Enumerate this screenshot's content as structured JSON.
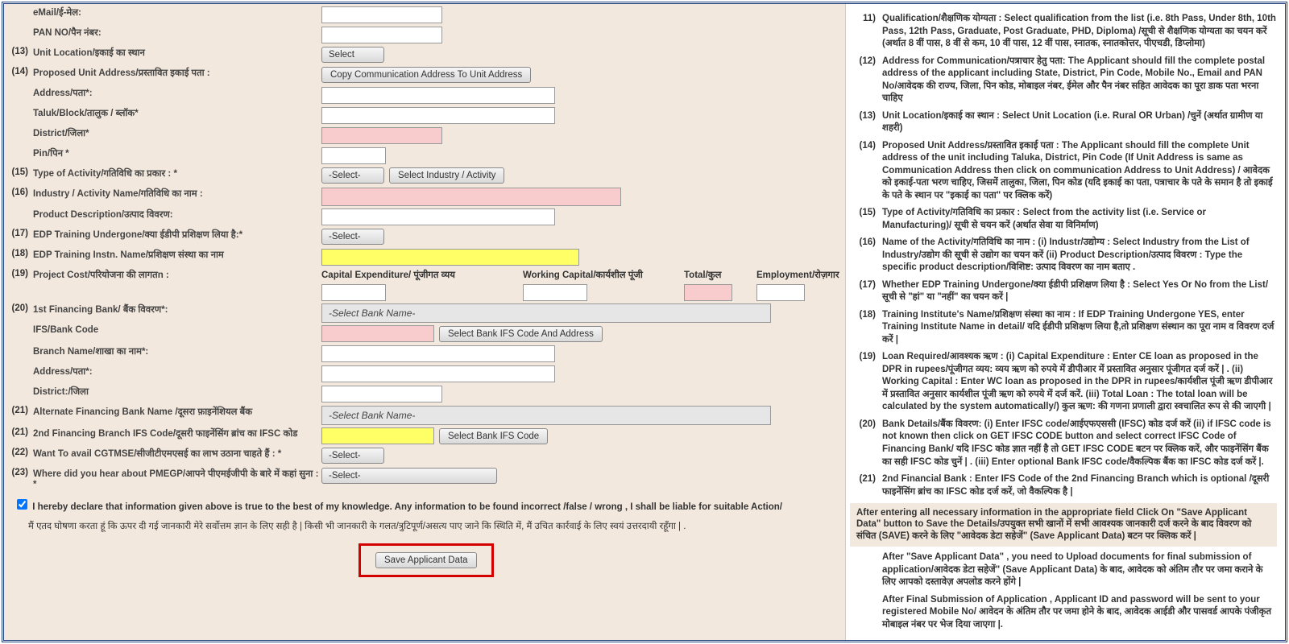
{
  "form": {
    "email_lbl": "eMail/ई-मेल:",
    "pan_lbl": "PAN NO/पैन नंबर:",
    "r13_lbl": "Unit Location/इकाई का स्थान",
    "r13_select": "Select",
    "r14_lbl": "Proposed Unit Address/प्रस्तावित इकाई पता :",
    "r14_btn": "Copy Communication Address To Unit Address",
    "address_lbl": "Address/पता*:",
    "taluk_lbl": "Taluk/Block/तालुक / ब्लॉक*",
    "district_lbl": "District/जिला*",
    "pin_lbl": "Pin/पिन *",
    "r15_lbl": "Type of Activity/गतिविधि का प्रकार : *",
    "r15_sel": "-Select-",
    "r15_btn": "Select Industry / Activity",
    "r16_lbl": "Industry / Activity Name/गतिविधि का नाम :",
    "proddesc_lbl": "Product Description/उत्पाद विवरण:",
    "r17_lbl": "EDP Training Undergone/क्या ईडीपी प्रशिक्षण लिया है:*",
    "r17_sel": "-Select-",
    "r18_lbl": "EDP Training Instn. Name/प्रशिक्षण संस्था का नाम",
    "r19_lbl": "Project Cost/परियोजना की लागतn :",
    "pc_cap": "Capital Expenditure/ पूंजीगत व्यय",
    "pc_wc": "Working Capital/कार्यशील पूंजी",
    "pc_total": "Total/कुल",
    "pc_emp": "Employment/रोज़गार",
    "r20_lbl": "1st Financing Bank/ बैंक विवरण*:",
    "r20_sel": "-Select Bank Name-",
    "ifs_lbl": "IFS/Bank Code",
    "ifs_btn": "Select  Bank IFS Code And Address",
    "branch_lbl": "Branch Name/शाखा का नाम*:",
    "baddress_lbl": "Address/पता*:",
    "bdistrict_lbl": "District:/जिला",
    "r21a_lbl": "Alternate Financing Bank Name /दूसरा फ़ाइनेंशियल बैंक",
    "r21a_sel": "-Select Bank Name-",
    "r21b_lbl": "2nd Financing Branch IFS Code/दूसरी फाइनेंसिंग ब्रांच का IFSC कोड",
    "r21b_btn": "Select  Bank IFS Code",
    "r22_lbl": "Want To avail CGTMSE/सीजीटीएमएसई का लाभ उठाना चाहते हैं : *",
    "r22_sel": "-Select-",
    "r23_lbl": "Where did you hear about PMEGP/आपने पीएमईजीपी के बारे में कहां सुना : *",
    "r23_sel": "-Select-",
    "decl_en": "I hereby declare that information given above is true to the best of my knowledge. Any information to be found incorrect /false / wrong , I shall be liable for suitable Action/",
    "decl_hi": "मैं एतद घोषणा करता हूं कि ऊपर दी गई जानकारी मेरे सर्वोत्तम ज्ञान के लिए सही है | किसी भी जानकारी के गलत/त्रुटिपूर्ण/असत्य पाए जाने कि स्थिति में, मैं उचित कार्रवाई के लिए स्वयं उत्तरदायी रहूँगा | .",
    "save_btn": "Save Applicant Data"
  },
  "instr": {
    "i11": "Qualification/शैक्षणिक योग्यता : Select qualification from the list (i.e. 8th Pass, Under 8th, 10th Pass, 12th Pass, Graduate, Post Graduate, PHD, Diploma) /सूची से शैक्षणिक योग्यता का चयन करें (अर्थात 8 वीं पास, 8 वीं से कम, 10 वीं पास, 12 वीं पास, स्नातक, स्नातकोत्तर, पीएचडी, डिप्लोमा)",
    "i12": "Address for Communication/पत्राचार हेतु पता: The Applicant should fill the complete postal address of the applicant including State, District, Pin Code, Mobile No., Email and PAN No/आवेदक की राज्य, जिला, पिन कोड, मोबाइल नंबर, ईमेल और पैन नंबर सहित आवेदक का पूरा डाक पता भरना चाहिए",
    "i13": "Unit Location/इकाई का स्थान : Select Unit Location (i.e. Rural OR Urban)  /चुनें (अर्थात ग्रामीण या शहरी)",
    "i14": "Proposed Unit Address/प्रस्तावित इकाई पता : The Applicant should fill the complete Unit address of the unit including Taluka, District, Pin Code (If Unit Address is same as Communication Address then click on communication Address to Unit Address)  / आवेदक को इकाई-पता भरण चाहिए, जिसमें तालुका, जिला,\nपिन कोड (यदि इकाई का पता, पत्राचार के पते के समान है तो इकाई के पते के स्थान पर \"इकाई का पता\" पर क्लिक करें)",
    "i15": "Type of Activity/गतिविधि का प्रकार : Select from the activity list (i.e. Service or Manufacturing)/ सूची से चयन करें (अर्थात सेवा या विनिर्माण)",
    "i16": "Name of the Activity/गतिविधि का नाम : (i) Industr/उद्योग्य : Select Industry from the List of Industry/उद्योग की सूची से उद्योग का चयन करें (ii) Product Description/उत्पाद विवरण : Type the specific product description/विशिष्ट: उत्पाद विवरण का नाम बताए .",
    "i17": "Whether EDP Training Undergone/क्या ईडीपी प्रशिक्षण लिया है : Select Yes Or No from the List/सूची से \"हां\" या \"नहीं\" का चयन करें |",
    "i18": "Training Institute's Name/प्रशिक्षण संस्था का नाम : If EDP Training Undergone YES, enter Training Institute Name in detail/ यदि ईडीपी प्रशिक्षण लिया है,तो प्रशिक्षण संस्थान का पूरा नाम व विवरण दर्ज करें |",
    "i19": "Loan Required/आवश्यक ऋण : (i) Capital Expenditure : Enter CE loan as proposed in the DPR in rupees/पूंजीगत व्यय: व्यय ऋण को रुपये में डीपीआर में प्रस्तावित अनुसार पूंजीगत दर्ज करें | . (ii) Working Capital : Enter WC loan as proposed in the DPR in rupees/कार्यशील पूंजी ऋण डीपीआर में प्रस्तावित अनुसार कार्यशील पूंजी ऋण को रुपये में दर्ज करें. (iii) Total Loan : The total loan will be calculated by the system automatically/) कुल ऋण: की गणना प्रणाली द्वारा स्वचालित रूप से की जाएगी |",
    "i20": "Bank Details/बैंक विवरण: (i) Enter IFSC code/आईएफएससी (IFSC) कोड दर्ज करें (ii) if IFSC code is not known then click on GET IFSC CODE button and select correct IFSC Code of Financing Bank/ यदि IFSC कोड ज्ञात नहीं है तो GET IFSC CODE बटन पर क्लिक करें, और फाइनेंसिंग बैंक का सही IFSC कोड चुनें | . (iii) Enter optional Bank IFSC code/वैकल्पिक बैंक का IFSC कोड दर्ज करें |.",
    "i21": "2nd Financial Bank : Enter IFS Code of the 2nd Financing Branch which is optional /दूसरी फाइनेंसिंग ब्रांच का IFSC कोड दर्ज करें, जो वैकल्पिक है |",
    "note1": "After entering all necessary information in the appropriate field Click On \"Save Applicant Data\" button to Save the Details/उपयुक्त सभी खानों में सभी आवश्यक जानकारी दर्ज करने के बाद विवरण को संचित (SAVE) करने के लिए \"आवेदक डेटा सहेजें\" (Save Applicant Data) बटन पर क्लिक करें |",
    "note2": "After \"Save Applicant Data\" , you need to Upload documents for final submission of application/आवेदक डेटा सहेजें\" (Save Applicant Data) के बाद, आवेदक को अंतिम तौर पर जमा कराने के लिए आपको दस्तावेज़ अपलोड करने होंगे |",
    "note3": "After Final Submission of Application , Applicant ID and password will be sent to your registered Mobile No/ आवेदन के अंतिम तौर पर जमा होने के बाद, आवेदक आईडी और पासवर्ड आपके पंजीकृत मोबाइल नंबर पर भेज दिया जाएगा |."
  }
}
